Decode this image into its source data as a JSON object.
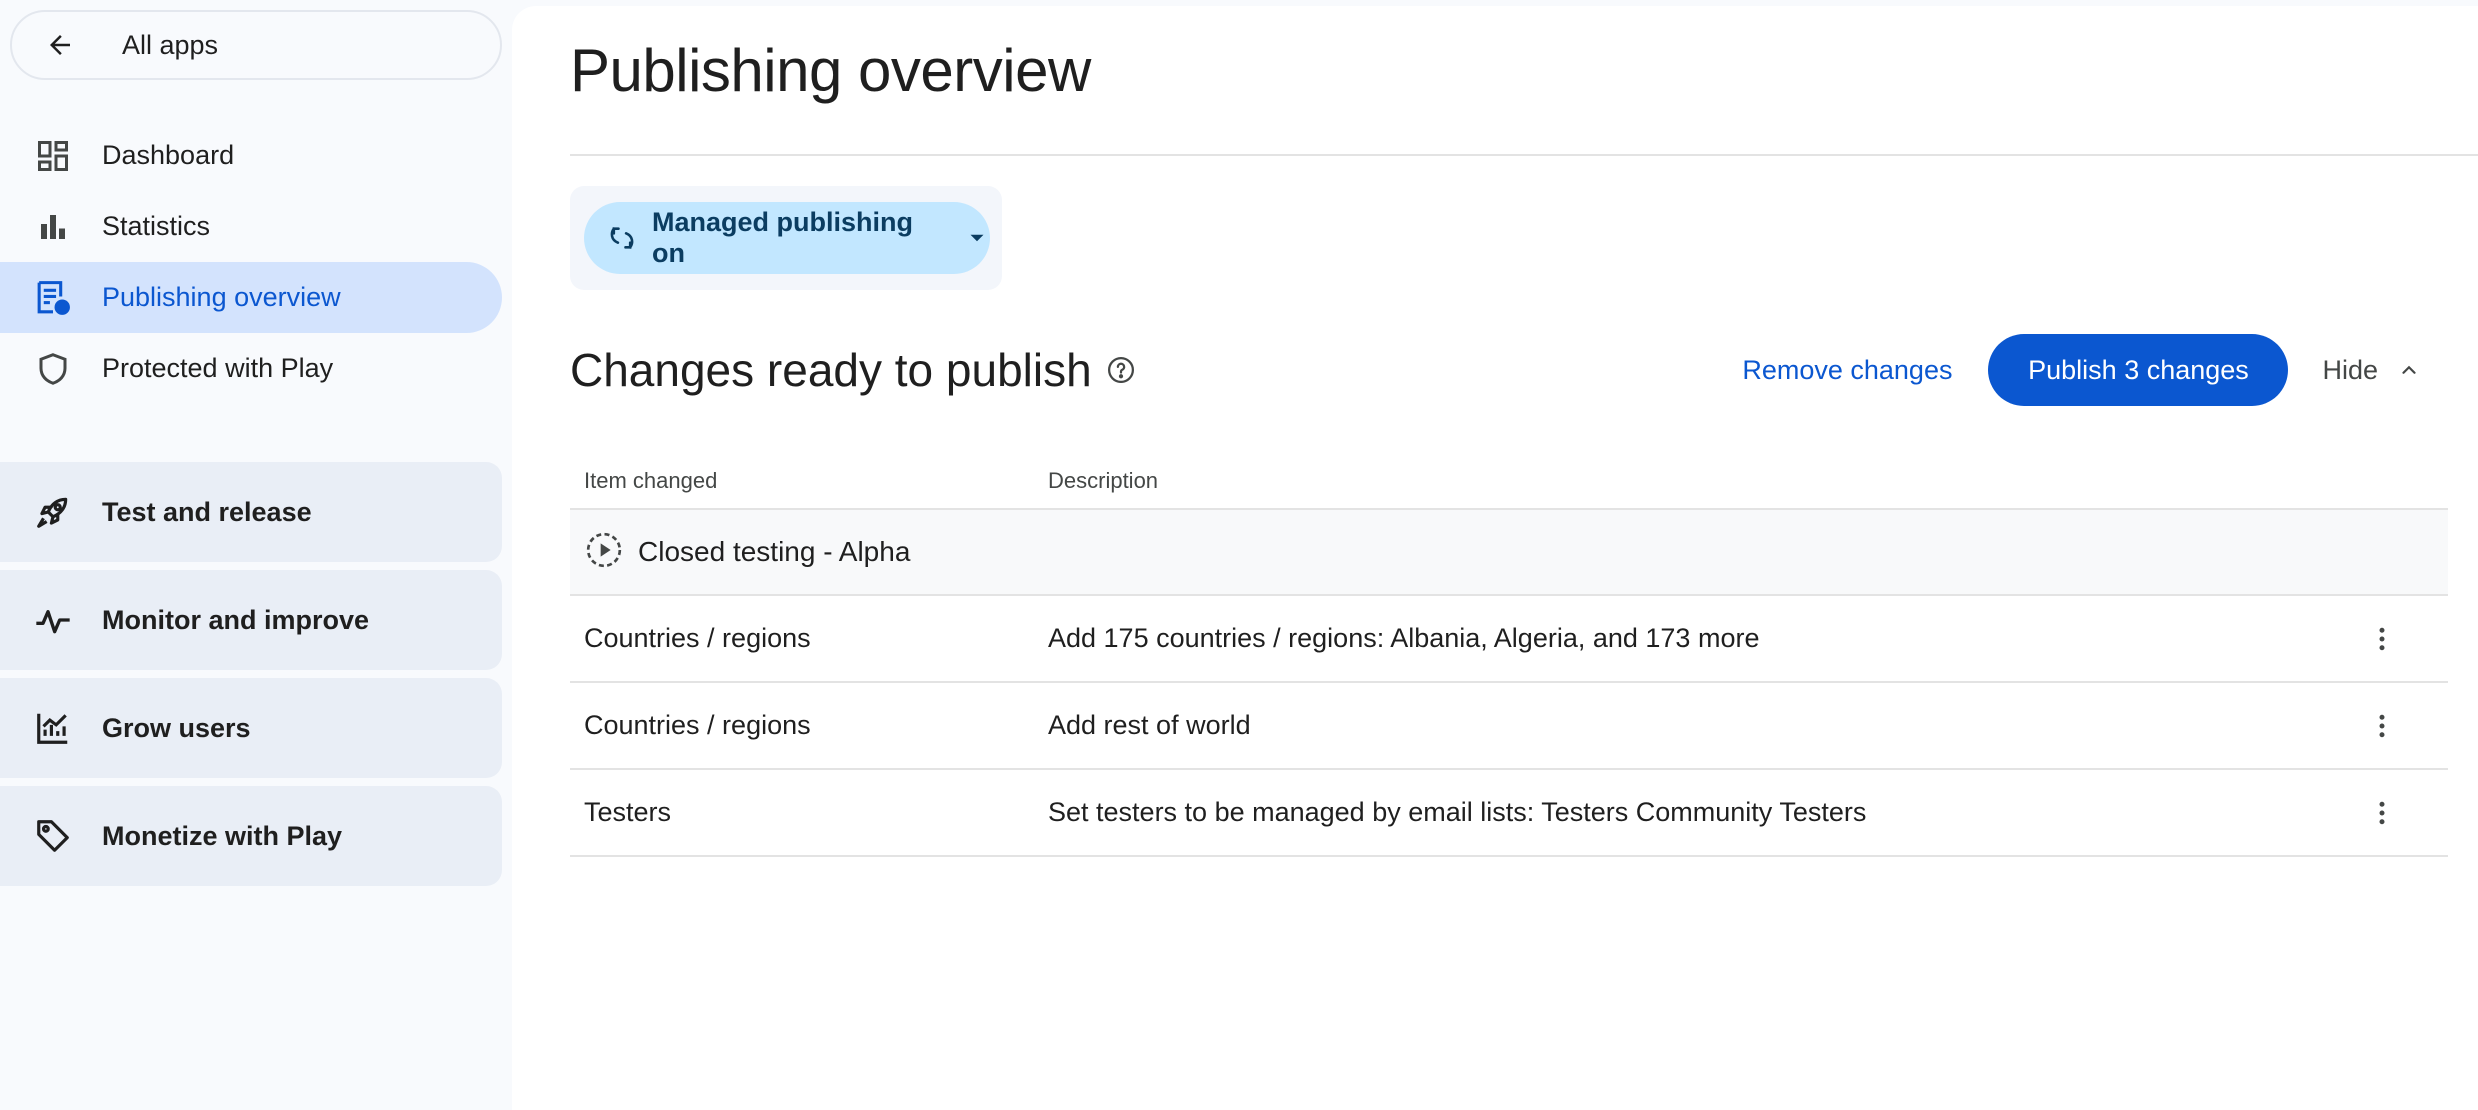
{
  "sidebar": {
    "back_label": "All apps",
    "nav": [
      {
        "label": "Dashboard",
        "icon": "dashboard-icon"
      },
      {
        "label": "Statistics",
        "icon": "bar-chart-icon"
      },
      {
        "label": "Publishing overview",
        "icon": "publishing-overview-icon",
        "active": true
      },
      {
        "label": "Protected with Play",
        "icon": "shield-icon"
      }
    ],
    "sections": [
      {
        "label": "Test and release",
        "icon": "rocket-icon"
      },
      {
        "label": "Monitor and improve",
        "icon": "pulse-icon"
      },
      {
        "label": "Grow users",
        "icon": "growth-chart-icon"
      },
      {
        "label": "Monetize with Play",
        "icon": "tag-icon"
      }
    ]
  },
  "main": {
    "title": "Publishing overview",
    "managed_publishing": {
      "label": "Managed publishing on",
      "icon": "sync-icon"
    },
    "changes": {
      "title": "Changes ready to publish",
      "remove_label": "Remove changes",
      "publish_label": "Publish 3 changes",
      "hide_label": "Hide",
      "columns": [
        "Item changed",
        "Description"
      ],
      "group": {
        "label": "Closed testing - Alpha",
        "icon": "closed-testing-icon"
      },
      "rows": [
        {
          "item": "Countries / regions",
          "description": "Add 175 countries / regions: Albania, Algeria, and 173 more"
        },
        {
          "item": "Countries / regions",
          "description": "Add rest of world"
        },
        {
          "item": "Testers",
          "description": "Set testers to be managed by email lists: Testers Community Testers"
        }
      ]
    }
  },
  "colors": {
    "accent": "#0b57d0",
    "active_nav_bg": "#d3e3fd",
    "chip_bg": "#c2e7ff",
    "section_bg": "#e9eef6",
    "sidebar_bg": "#f8fafd"
  }
}
